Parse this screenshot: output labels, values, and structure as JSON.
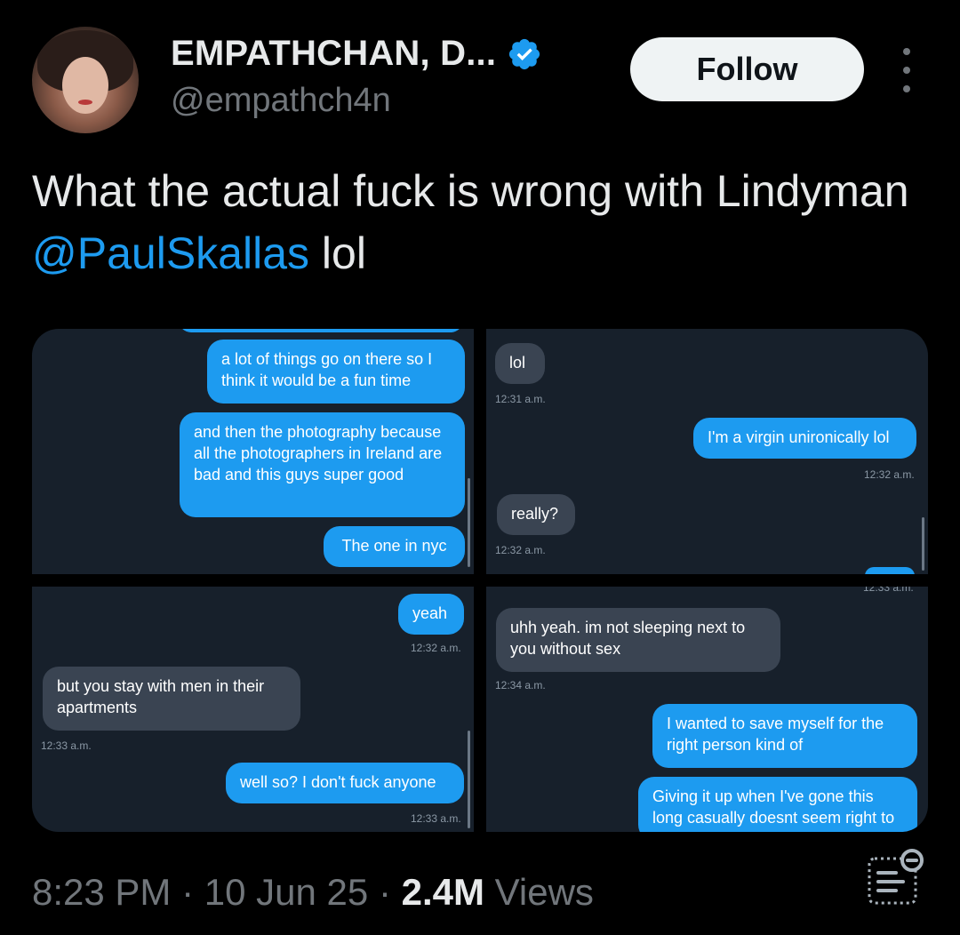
{
  "author": {
    "display_name": "EMPATHCHAN, D...",
    "handle": "@empathch4n",
    "verified": true
  },
  "follow_label": "Follow",
  "tweet": {
    "text_before": "What the actual fuck is wrong with Lindyman ",
    "mention": "@PaulSkallas",
    "text_after": " lol"
  },
  "media": {
    "panel1": {
      "bubbles": [
        "a lot of things go on there so I think it would be a fun time",
        "and then the photography because all the photographers in Ireland are bad and this guys super good",
        "The one in nyc"
      ]
    },
    "panel2": {
      "bubbles": [
        "lol",
        "I'm a virgin unironically lol",
        "really?"
      ],
      "timestamps": [
        "12:31 a.m.",
        "12:32 a.m.",
        "12:32 a.m.",
        "12:33 a.m."
      ]
    },
    "panel3": {
      "bubbles": [
        "yeah",
        "but you stay with men in their apartments",
        "well so? I don't fuck anyone"
      ],
      "timestamps": [
        "12:32 a.m.",
        "12:33 a.m.",
        "12:33 a.m."
      ]
    },
    "panel4": {
      "bubbles": [
        "uhh yeah. im not sleeping next to you without sex",
        "I wanted to save myself for the right person kind of",
        "Giving it up when I've gone this long casually doesnt seem right to"
      ],
      "timestamps": [
        "12:34 a.m."
      ]
    }
  },
  "meta": {
    "time": "8:23 PM",
    "date": "10 Jun 25",
    "views_count": "2.4M",
    "views_label": "Views",
    "separator": "·"
  },
  "colors": {
    "accent": "#1d9bf0",
    "background": "#000000",
    "muted": "#71767b"
  },
  "icons": [
    "verified-badge-icon",
    "more-options-icon",
    "analytics-icon"
  ]
}
